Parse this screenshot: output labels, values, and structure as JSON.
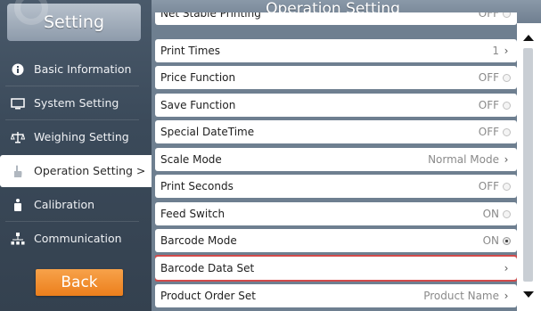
{
  "sidebar": {
    "title": "Setting",
    "items": [
      {
        "label": "Basic Information",
        "icon": "info-icon",
        "active": false
      },
      {
        "label": "System Setting",
        "icon": "monitor-icon",
        "active": false
      },
      {
        "label": "Weighing Setting",
        "icon": "scale-icon",
        "active": false
      },
      {
        "label": "Operation Setting >",
        "icon": "hand-icon",
        "active": true
      },
      {
        "label": "Calibration",
        "icon": "weight-icon",
        "active": false
      },
      {
        "label": "Communication",
        "icon": "network-icon",
        "active": false
      }
    ],
    "back_label": "Back"
  },
  "main": {
    "title": "Operation Setting",
    "rows": [
      {
        "label": "Net Stable Printing",
        "value": "OFF",
        "control": "toggle-off"
      },
      {
        "label": "Print Times",
        "value": "1",
        "control": "chevron"
      },
      {
        "label": "Price Function",
        "value": "OFF",
        "control": "toggle-off"
      },
      {
        "label": "Save Function",
        "value": "OFF",
        "control": "toggle-off"
      },
      {
        "label": "Special DateTime",
        "value": "OFF",
        "control": "toggle-off"
      },
      {
        "label": "Scale Mode",
        "value": "Normal Mode",
        "control": "chevron"
      },
      {
        "label": "Print Seconds",
        "value": "OFF",
        "control": "toggle-off"
      },
      {
        "label": "Feed Switch",
        "value": "ON",
        "control": "toggle-off"
      },
      {
        "label": "Barcode Mode",
        "value": "ON",
        "control": "toggle-on"
      },
      {
        "label": "Barcode Data Set",
        "value": "",
        "control": "chevron",
        "selected": true
      },
      {
        "label": "Product Order Set",
        "value": "Product Name",
        "control": "chevron"
      }
    ]
  },
  "colors": {
    "accent_orange": "#ec7f1c",
    "selection_red": "#d24b4b",
    "sidebar_bg": "#3b4a5a",
    "header_bg": "#6f7f90"
  }
}
